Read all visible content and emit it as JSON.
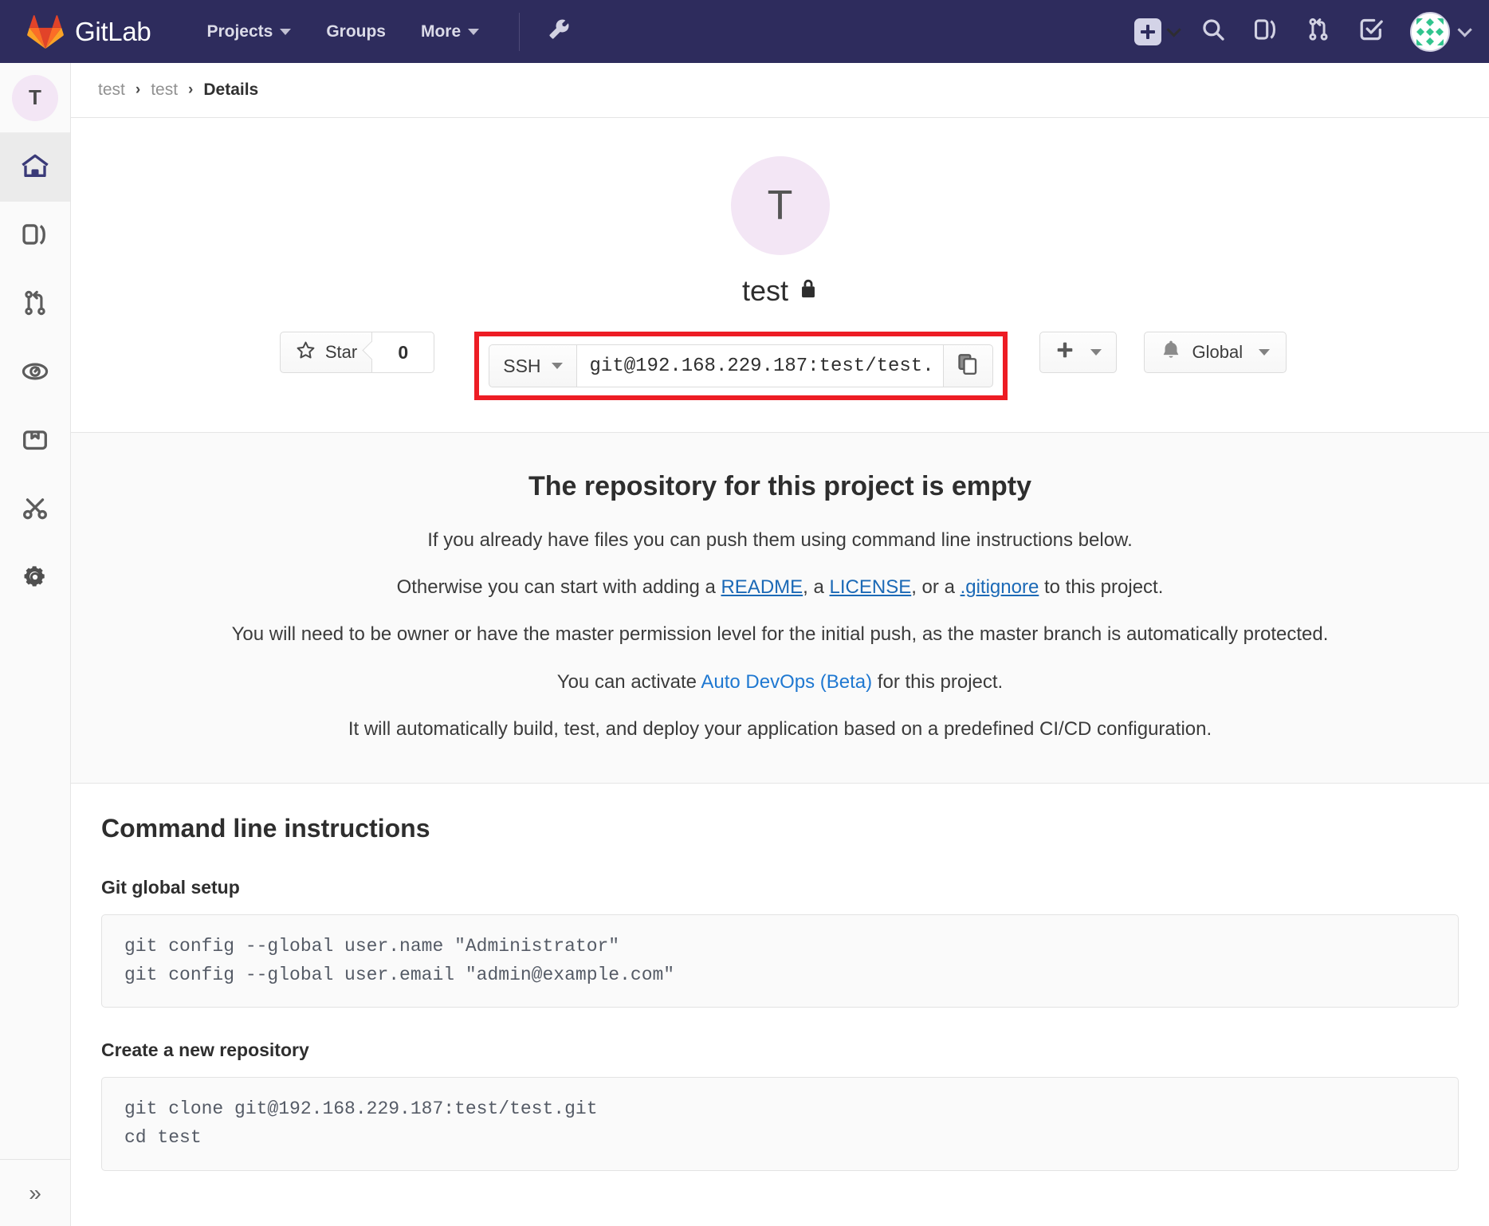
{
  "topnav": {
    "brand": "GitLab",
    "brand_icon": "gitlab-tanuki-logo",
    "items": [
      {
        "label": "Projects",
        "icon": "chevron-down-icon"
      },
      {
        "label": "Groups",
        "icon": ""
      },
      {
        "label": "More",
        "icon": "chevron-down-icon"
      }
    ],
    "admin_icon": "wrench-icon",
    "right_icons": [
      "new-plus-icon",
      "search-icon",
      "issues-icon",
      "merge-requests-icon",
      "todos-icon"
    ],
    "avatar_icon": "user-avatar-identicon",
    "bg_color": "#2e2c5d"
  },
  "sidebar": {
    "project_initial": "T",
    "items": [
      {
        "name": "project-overview",
        "icon": "home-icon",
        "active": true
      },
      {
        "name": "issues",
        "icon": "issues-book-icon",
        "active": false
      },
      {
        "name": "merge-requests",
        "icon": "merge-request-icon",
        "active": false
      },
      {
        "name": "ci-cd",
        "icon": "rocket-gauge-icon",
        "active": false
      },
      {
        "name": "packages",
        "icon": "package-icon",
        "active": false
      },
      {
        "name": "snippets",
        "icon": "scissors-icon",
        "active": false
      },
      {
        "name": "settings",
        "icon": "gear-icon",
        "active": false
      }
    ],
    "collapse_icon": "double-chevron-right-icon",
    "collapse_label": "»"
  },
  "breadcrumb": {
    "items": [
      "test",
      "test",
      "Details"
    ],
    "separator": "›"
  },
  "project": {
    "avatar_initial": "T",
    "name": "test",
    "visibility_icon": "lock-icon",
    "visibility": "private"
  },
  "actions": {
    "star_label": "Star",
    "star_icon": "star-outline-icon",
    "star_count": "0",
    "clone_protocol": "SSH",
    "clone_protocol_icon": "caret-down-icon",
    "clone_url": "git@192.168.229.187:test/test.",
    "copy_icon": "copy-to-clipboard-icon",
    "plus_icon": "plus-icon",
    "plus_caret_icon": "caret-down-icon",
    "notification_icon": "bell-icon",
    "notification_label": "Global",
    "notification_caret_icon": "caret-down-icon",
    "highlight_color": "#ed1c24"
  },
  "empty_repo": {
    "heading": "The repository for this project is empty",
    "line1": "If you already have files you can push them using command line instructions below.",
    "line2_pre": "Otherwise you can start with adding a ",
    "line2_readme": "README",
    "line2_mid1": ", a ",
    "line2_license": "LICENSE",
    "line2_mid2": ", or a ",
    "line2_gitignore": ".gitignore",
    "line2_post": " to this project.",
    "line3": "You will need to be owner or have the master permission level for the initial push, as the master branch is automatically protected.",
    "line4_pre": "You can activate ",
    "line4_link": "Auto DevOps (Beta)",
    "line4_post": " for this project.",
    "line5": "It will automatically build, test, and deploy your application based on a predefined CI/CD configuration."
  },
  "cli": {
    "heading": "Command line instructions",
    "sections": [
      {
        "title": "Git global setup",
        "code": "git config --global user.name \"Administrator\"\ngit config --global user.email \"admin@example.com\""
      },
      {
        "title": "Create a new repository",
        "code": "git clone git@192.168.229.187:test/test.git\ncd test"
      }
    ]
  }
}
